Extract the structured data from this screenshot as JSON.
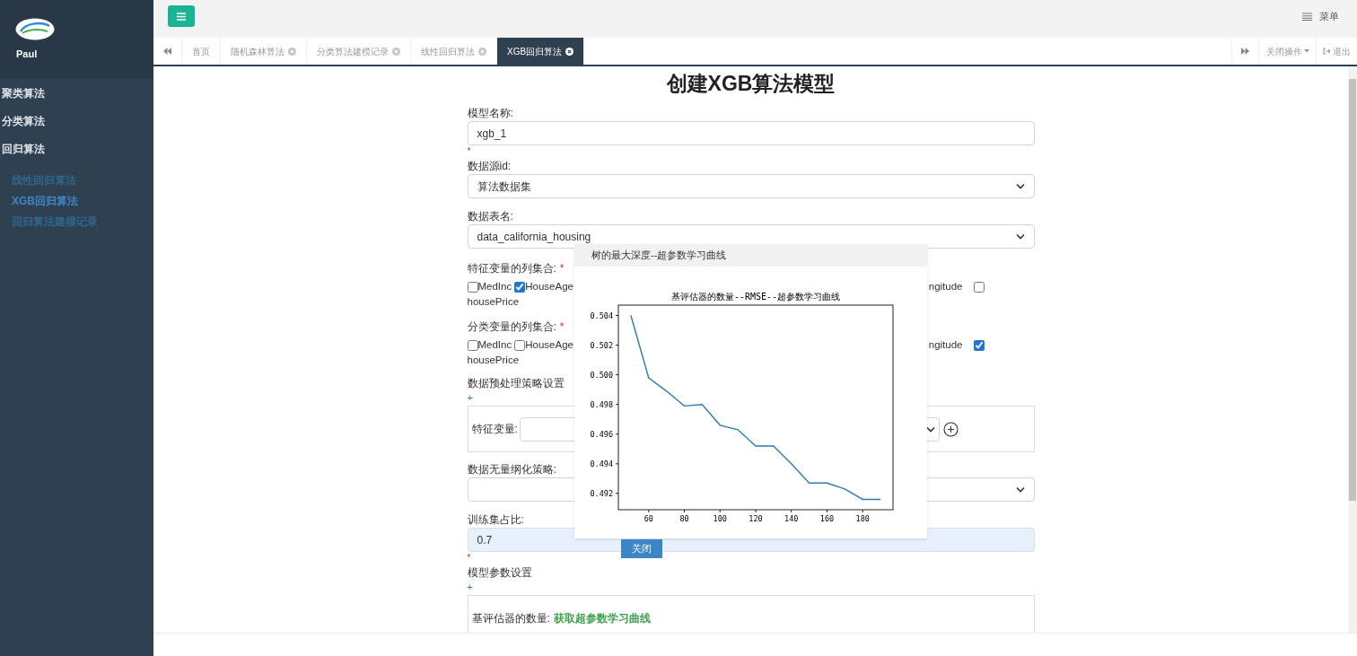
{
  "sidebar": {
    "user": "Paul",
    "menu": [
      {
        "label": "聚类算法"
      },
      {
        "label": "分类算法"
      },
      {
        "label": "回归算法",
        "children": [
          {
            "label": "线性回归算法",
            "selected": false
          },
          {
            "label": "XGB回归算法",
            "selected": true
          },
          {
            "label": "回归算法建模记录",
            "selected": false
          }
        ]
      }
    ]
  },
  "top_bar": {
    "menu_label": "菜单"
  },
  "tabs": [
    {
      "label": "首页",
      "closable": false,
      "selected": false
    },
    {
      "label": "随机森林算法",
      "closable": true,
      "selected": false
    },
    {
      "label": "分类算法建模记录",
      "closable": true,
      "selected": false
    },
    {
      "label": "线性回归算法",
      "closable": true,
      "selected": false
    },
    {
      "label": "XGB回归算法",
      "closable": true,
      "selected": true
    }
  ],
  "tab_actions": {
    "close_menu": "关闭操作",
    "logout": "退出"
  },
  "form": {
    "title": "创建XGB算法模型",
    "fields": [
      {
        "kind": "text",
        "label": "模型名称:",
        "value": "xgb_1",
        "after_mark": "*",
        "highlighted": false
      },
      {
        "kind": "select",
        "label": "数据源id:",
        "value": "算法数据集"
      },
      {
        "kind": "select",
        "label": "数据表名:",
        "value": "data_california_housing"
      },
      {
        "kind": "checkboxes",
        "label": "特征变量的列集合:",
        "label_mark": "*",
        "options": [
          {
            "label": "MedInc",
            "checked": false
          },
          {
            "label": "HouseAge",
            "checked": true
          }
        ],
        "cut_label": "ngitude",
        "last_option": {
          "label": "housePrice",
          "checked": false
        }
      },
      {
        "kind": "checkboxes",
        "label": "分类变量的列集合:",
        "label_mark": "*",
        "options": [
          {
            "label": "MedInc",
            "checked": false
          },
          {
            "label": "HouseAge",
            "checked": false
          }
        ],
        "cut_label": "ngitude",
        "last_option": {
          "label": "housePrice",
          "checked": true
        }
      },
      {
        "kind": "section",
        "label": "数据预处理策略设置",
        "add": "+",
        "row_label": "特征变量:"
      },
      {
        "kind": "select",
        "label": "数据无量纲化策略:"
      },
      {
        "kind": "text",
        "label": "训练集占比:",
        "value": "0.7",
        "after_mark": "*",
        "highlighted": true
      },
      {
        "kind": "section",
        "label": "模型参数设置",
        "add": "+",
        "row_label": "基评估器的数量:",
        "link": "获取超参数学习曲线"
      }
    ]
  },
  "modal": {
    "title": "树的最大深度--超参数学习曲线",
    "close_button": "关闭",
    "chart_data": {
      "type": "line",
      "title": "基评估器的数量--RMSE--超参数学习曲线",
      "x": [
        50,
        60,
        70,
        80,
        90,
        100,
        110,
        120,
        130,
        140,
        150,
        160,
        170,
        180,
        190
      ],
      "series": [
        {
          "color": "#2e7bb0",
          "values": [
            0.504,
            0.4998,
            0.4989,
            0.4979,
            0.498,
            0.4966,
            0.4963,
            0.4952,
            0.4952,
            0.494,
            0.4927,
            0.4927,
            0.4923,
            0.4916,
            0.4916
          ]
        }
      ],
      "xlim": [
        43,
        197
      ],
      "ylim": [
        0.4909,
        0.5047
      ],
      "xticks": [
        60,
        80,
        100,
        120,
        140,
        160,
        180
      ],
      "yticks": [
        {
          "value": 0.492,
          "label": "0.492"
        },
        {
          "value": 0.494,
          "label": "0.494"
        },
        {
          "value": 0.496,
          "label": "0.496"
        },
        {
          "value": 0.498,
          "label": "0.498"
        },
        {
          "value": 0.5,
          "label": "0.500"
        },
        {
          "value": 0.502,
          "label": "0.502"
        },
        {
          "value": 0.504,
          "label": "0.504"
        }
      ]
    }
  }
}
